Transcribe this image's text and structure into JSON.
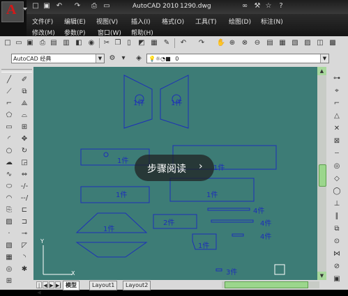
{
  "app_title": "AutoCAD 2010",
  "file_name": "1290.dwg",
  "menu": {
    "row1": [
      "文件(F)",
      "编辑(E)",
      "视图(V)",
      "插入(I)",
      "格式(O)",
      "工具(T)",
      "绘图(D)",
      "标注(N)"
    ],
    "row2": [
      "修改(M)",
      "参数(P)",
      "窗口(W)",
      "帮助(H)"
    ]
  },
  "toolbar": {
    "workspace": "AutoCAD 经典",
    "layer": "0"
  },
  "drawing": {
    "labels": [
      "1件",
      "1件",
      "1件",
      "1件",
      "1件",
      "1件",
      "4件",
      "4件",
      "4件",
      "2件",
      "1件",
      "3件",
      "1件"
    ],
    "ucs_y": "Y",
    "ucs_x": "X"
  },
  "layout_tabs": [
    "模型",
    "Layout1",
    "Layout2"
  ],
  "overlay": {
    "text": "步骤阅读",
    "chevron": "›"
  },
  "colors": {
    "canvas": "#3d7c76",
    "linework": "#1d2fb8",
    "scroll_accent": "#9bd68c"
  }
}
